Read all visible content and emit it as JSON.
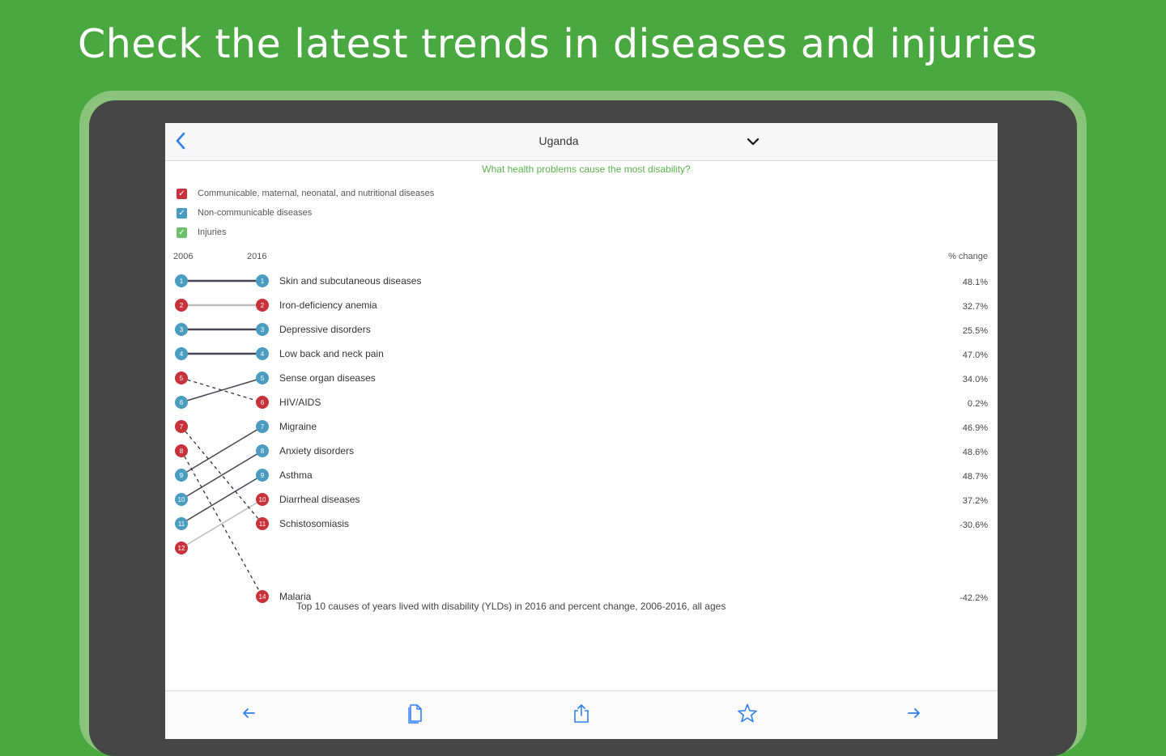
{
  "headline": "Check the latest trends in diseases and injuries",
  "nav": {
    "title": "Uganda"
  },
  "question": "What health problems cause the most disability?",
  "legend": [
    {
      "label": "Communicable, maternal, neonatal, and nutritional diseases",
      "color": "#c8323c"
    },
    {
      "label": "Non-communicable diseases",
      "color": "#4a9cc0"
    },
    {
      "label": "Injuries",
      "color": "#6cc06a"
    }
  ],
  "headers": {
    "start_year": "2006",
    "end_year": "2016",
    "change": "% change"
  },
  "caption": "Top 10 causes of years lived with disability (YLDs) in 2016 and percent change, 2006-2016, all ages",
  "colors": {
    "communicable": "#c8323c",
    "noncommunicable": "#4a9cc0",
    "injuries": "#6cc06a",
    "accent": "#2f7ff0",
    "brand_green": "#4aa840"
  },
  "chart_data": {
    "type": "slope",
    "x": [
      "2006",
      "2016"
    ],
    "causes": [
      {
        "name": "Skin and subcutaneous diseases",
        "group": "noncommunicable",
        "rank_2006": 1,
        "rank_2016": 1,
        "change": "48.1%"
      },
      {
        "name": "Iron-deficiency anemia",
        "group": "communicable",
        "rank_2006": 2,
        "rank_2016": 2,
        "change": "32.7%"
      },
      {
        "name": "Depressive disorders",
        "group": "noncommunicable",
        "rank_2006": 3,
        "rank_2016": 3,
        "change": "25.5%"
      },
      {
        "name": "Low back and neck pain",
        "group": "noncommunicable",
        "rank_2006": 4,
        "rank_2016": 4,
        "change": "47.0%"
      },
      {
        "name": "Sense organ diseases",
        "group": "noncommunicable",
        "rank_2006": 6,
        "rank_2016": 5,
        "change": "34.0%"
      },
      {
        "name": "HIV/AIDS",
        "group": "communicable",
        "rank_2006": 5,
        "rank_2016": 6,
        "change": "0.2%"
      },
      {
        "name": "Migraine",
        "group": "noncommunicable",
        "rank_2006": 9,
        "rank_2016": 7,
        "change": "46.9%"
      },
      {
        "name": "Anxiety disorders",
        "group": "noncommunicable",
        "rank_2006": 10,
        "rank_2016": 8,
        "change": "48.6%"
      },
      {
        "name": "Asthma",
        "group": "noncommunicable",
        "rank_2006": 11,
        "rank_2016": 9,
        "change": "48.7%"
      },
      {
        "name": "Diarrheal diseases",
        "group": "communicable",
        "rank_2006": 12,
        "rank_2016": 10,
        "change": "37.2%"
      },
      {
        "name": "Schistosomiasis",
        "group": "communicable",
        "rank_2006": 7,
        "rank_2016": 11,
        "change": "-30.6%"
      },
      {
        "name": "Malaria",
        "group": "communicable",
        "rank_2006": 8,
        "rank_2016": 14,
        "change": "-42.2%"
      }
    ]
  },
  "toolbar": {
    "buttons": [
      {
        "name": "back-arrow-button",
        "icon": "arrow-left-icon"
      },
      {
        "name": "document-button",
        "icon": "document-icon"
      },
      {
        "name": "share-button",
        "icon": "share-icon"
      },
      {
        "name": "favorite-button",
        "icon": "star-icon"
      },
      {
        "name": "forward-arrow-button",
        "icon": "arrow-right-icon"
      }
    ]
  }
}
